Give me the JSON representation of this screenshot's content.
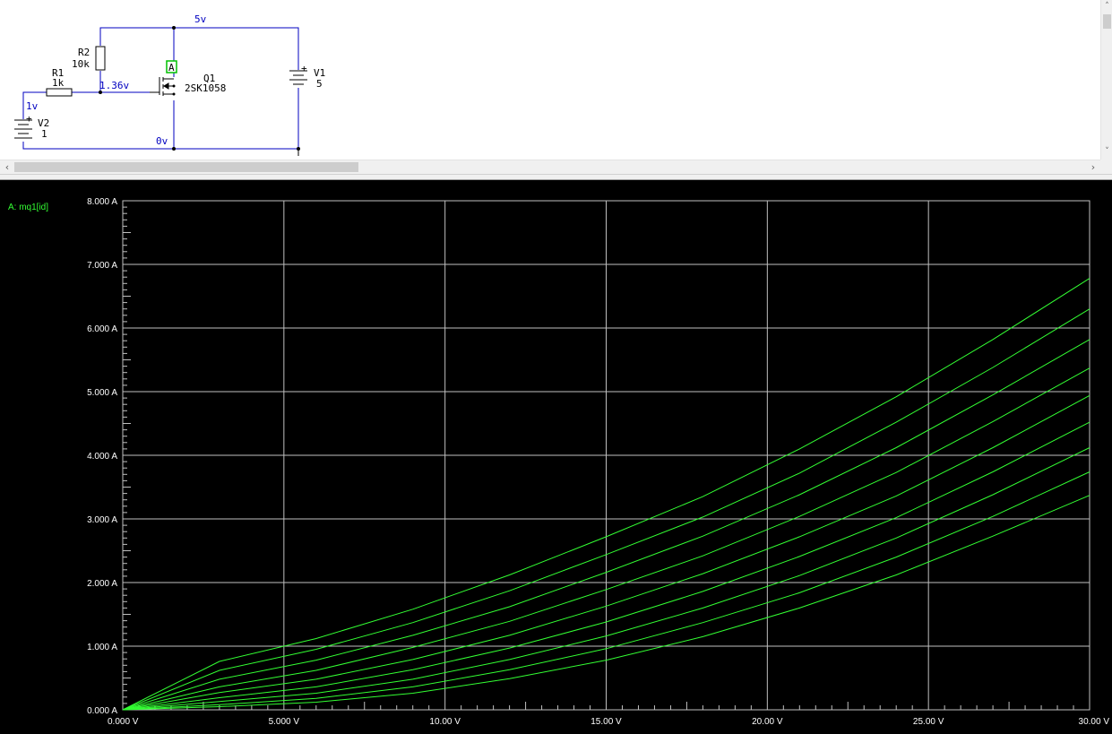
{
  "schematic": {
    "components": {
      "r2": {
        "ref": "R2",
        "value": "10k"
      },
      "r1": {
        "ref": "R1",
        "value": "1k"
      },
      "q1": {
        "ref": "Q1",
        "value": "2SK1058"
      },
      "v1": {
        "ref": "V1",
        "value": "5"
      },
      "v2": {
        "ref": "V2",
        "value": "1"
      }
    },
    "node_labels": {
      "top": "5v",
      "gate": "1.36v",
      "input": "1v",
      "ground": "0v"
    },
    "probe_label": "A",
    "plus_sign": "+",
    "colors": {
      "wire": "#0000c0",
      "node_text": "#0000c0",
      "probe": "#00c000"
    }
  },
  "scrollbars": {
    "left_arrow": "‹",
    "right_arrow": "›",
    "up_arrow": "˄",
    "down_arrow": "˅"
  },
  "chart_data": {
    "type": "line",
    "series_label": "A: mq1[id]",
    "xlim": [
      0,
      30
    ],
    "ylim": [
      0,
      8
    ],
    "x_ticks": [
      "0.000 V",
      "5.000 V",
      "10.00 V",
      "15.00 V",
      "20.00 V",
      "25.00 V",
      "30.00 V"
    ],
    "y_ticks": [
      "0.000 A",
      "1.000 A",
      "2.000 A",
      "3.000 A",
      "4.000 A",
      "5.000 A",
      "6.000 A",
      "7.000 A",
      "8.000 A"
    ],
    "grid": true,
    "colors": {
      "trace": "#33ff33",
      "grid": "#c0c0c0",
      "text": "#ffffff",
      "background": "#000000"
    },
    "x": [
      0,
      3,
      6,
      9,
      12,
      15,
      18,
      21,
      24,
      27,
      30
    ],
    "series": [
      {
        "values": [
          0,
          0.76,
          1.12,
          1.58,
          2.12,
          2.72,
          3.35,
          4.1,
          4.92,
          5.82,
          6.78
        ]
      },
      {
        "values": [
          0,
          0.62,
          0.95,
          1.37,
          1.87,
          2.44,
          3.03,
          3.72,
          4.52,
          5.38,
          6.3
        ]
      },
      {
        "values": [
          0,
          0.48,
          0.78,
          1.17,
          1.62,
          2.16,
          2.73,
          3.38,
          4.12,
          4.95,
          5.82
        ]
      },
      {
        "values": [
          0,
          0.36,
          0.62,
          0.98,
          1.39,
          1.89,
          2.42,
          3.04,
          3.73,
          4.53,
          5.37
        ]
      },
      {
        "values": [
          0,
          0.27,
          0.48,
          0.79,
          1.17,
          1.63,
          2.14,
          2.72,
          3.36,
          4.12,
          4.94
        ]
      },
      {
        "values": [
          0,
          0.19,
          0.36,
          0.63,
          0.97,
          1.38,
          1.86,
          2.41,
          3.02,
          3.74,
          4.52
        ]
      },
      {
        "values": [
          0,
          0.13,
          0.26,
          0.48,
          0.79,
          1.16,
          1.6,
          2.11,
          2.7,
          3.38,
          4.12
        ]
      },
      {
        "values": [
          0,
          0.08,
          0.18,
          0.36,
          0.63,
          0.96,
          1.37,
          1.84,
          2.4,
          3.04,
          3.74
        ]
      },
      {
        "values": [
          0,
          0.05,
          0.12,
          0.26,
          0.49,
          0.78,
          1.15,
          1.6,
          2.12,
          2.73,
          3.37
        ]
      }
    ]
  }
}
